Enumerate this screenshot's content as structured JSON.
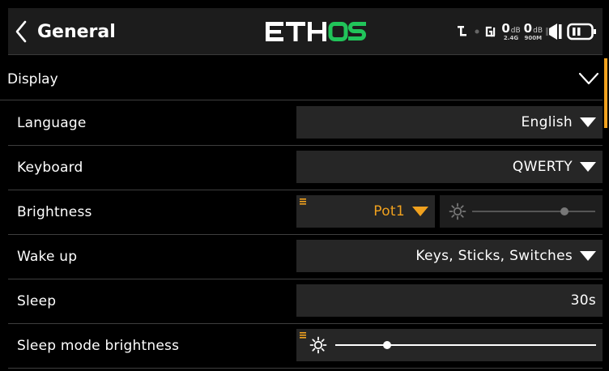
{
  "header": {
    "title": "General",
    "logo": "ETHOS",
    "status": {
      "rssi_24": {
        "value": "0",
        "unit": "dB",
        "band": "2.4G"
      },
      "rssi_900": {
        "value": "0",
        "unit": "dB",
        "band": "900M"
      }
    }
  },
  "section": {
    "label": "Display",
    "expanded": true
  },
  "rows": {
    "language": {
      "label": "Language",
      "value": "English"
    },
    "keyboard": {
      "label": "Keyboard",
      "value": "QWERTY"
    },
    "brightness": {
      "label": "Brightness",
      "source": "Pot1",
      "level": 0.75
    },
    "wakeup": {
      "label": "Wake up",
      "value": "Keys, Sticks, Switches"
    },
    "sleep": {
      "label": "Sleep",
      "value": "30s"
    },
    "sleep_brightness": {
      "label": "Sleep mode brightness",
      "level": 0.2
    }
  },
  "colors": {
    "accent": "#f0a11e",
    "field_bg": "#262626",
    "header_bg": "#1c1c1c",
    "logo_green": "#21c45a"
  },
  "icons": [
    "back-chevron-icon",
    "trim-l-icon",
    "gps-icon",
    "speaker-icon",
    "battery-icon",
    "chevron-down-icon",
    "dropdown-caret-icon",
    "menu-lines-icon",
    "sun-icon"
  ]
}
